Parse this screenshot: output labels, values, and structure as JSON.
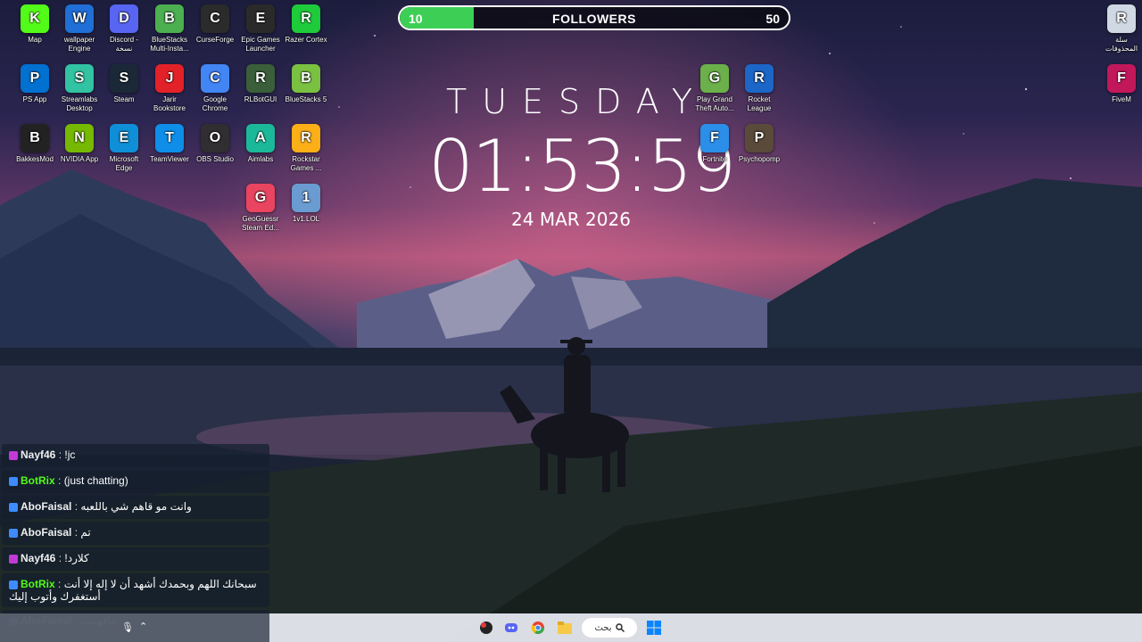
{
  "followers_goal": {
    "title": "FOLLOWERS",
    "start_label": "10",
    "end_label": "50",
    "progress_fraction": 0.19,
    "fill_color": "#3dcf55"
  },
  "clock": {
    "day": "TUESDAY",
    "time": "01:53:59",
    "date": "24 MAR 2026"
  },
  "desktop_icons": [
    {
      "label": "Map",
      "icon": "kick-icon",
      "color": "#53fc18"
    },
    {
      "label": "wallpaper Engine",
      "icon": "wallpaper-engine-icon",
      "color": "#1f6fd6"
    },
    {
      "label": "Discord - نسخة",
      "icon": "discord-icon",
      "color": "#5865f2"
    },
    {
      "label": "BlueStacks Multi-Insta...",
      "icon": "bluestacks-multi-icon",
      "color": "#4caf50"
    },
    {
      "label": "CurseForge",
      "icon": "curseforge-icon",
      "color": "#2b2b2b"
    },
    {
      "label": "Epic Games Launcher",
      "icon": "epic-games-icon",
      "color": "#2a2a2a"
    },
    {
      "label": "Razer Cortex",
      "icon": "razer-cortex-icon",
      "color": "#1ecb3a"
    },
    {
      "label": "PS App",
      "icon": "playstation-icon",
      "color": "#0070d1"
    },
    {
      "label": "Streamlabs Desktop",
      "icon": "streamlabs-icon",
      "color": "#31c3a2"
    },
    {
      "label": "Steam",
      "icon": "steam-icon",
      "color": "#1b2838"
    },
    {
      "label": "Jarir Bookstore",
      "icon": "jarir-icon",
      "color": "#e32128"
    },
    {
      "label": "Google Chrome",
      "icon": "chrome-icon",
      "color": "#4285f4"
    },
    {
      "label": "RLBotGUI",
      "icon": "rlbot-icon",
      "color": "#3a5f3a"
    },
    {
      "label": "BlueStacks 5",
      "icon": "bluestacks-icon",
      "color": "#7ac142"
    },
    {
      "label": "BakkesMod",
      "icon": "bakkesmod-icon",
      "color": "#222222"
    },
    {
      "label": "NVIDIA App",
      "icon": "nvidia-icon",
      "color": "#76b900"
    },
    {
      "label": "Microsoft Edge",
      "icon": "edge-icon",
      "color": "#0f8fd8"
    },
    {
      "label": "TeamViewer",
      "icon": "teamviewer-icon",
      "color": "#0e8ee9"
    },
    {
      "label": "OBS Studio",
      "icon": "obs-icon",
      "color": "#302e31"
    },
    {
      "label": "Aimlabs",
      "icon": "aimlabs-icon",
      "color": "#1bb99a"
    },
    {
      "label": "Rockstar Games ...",
      "icon": "rockstar-icon",
      "color": "#fcaf17"
    },
    {
      "label": "GeoGuessr Steam Ed...",
      "icon": "geoguessr-icon",
      "color": "#e94560"
    },
    {
      "label": "1v1.LOL",
      "icon": "1v1lol-icon",
      "color": "#6a9bd1"
    }
  ],
  "right_icons": [
    {
      "label": "Play Grand Theft Auto...",
      "icon": "gta-icon",
      "color": "#6bb04a"
    },
    {
      "label": "Rocket League",
      "icon": "rocket-league-icon",
      "color": "#1c66c7"
    },
    {
      "label": "Fortnite",
      "icon": "fortnite-icon",
      "color": "#2b8ee8"
    },
    {
      "label": "Psychopomp",
      "icon": "psychopomp-icon",
      "color": "#5a4a3a"
    }
  ],
  "corner_icons": [
    {
      "label": "سلة المحذوفات",
      "icon": "recycle-bin-icon",
      "color": "#cfd8e3"
    },
    {
      "label": "FiveM",
      "icon": "fivem-icon",
      "color": "#c2185b"
    }
  ],
  "chat": [
    {
      "user": "Nayf46",
      "user_color": "#f0f0f0",
      "badge_color": "#c23ad6",
      "message": "!jc"
    },
    {
      "user": "BotRix",
      "user_color": "#53fc18",
      "badge_color": "#3d8bff",
      "message": "(just chatting)"
    },
    {
      "user": "AboFaisal",
      "user_color": "#f0f0f0",
      "badge_color": "#3d8bff",
      "message": "وانت مو قاهم شي باللعبه"
    },
    {
      "user": "AboFaisal",
      "user_color": "#f0f0f0",
      "badge_color": "#3d8bff",
      "message": "تم"
    },
    {
      "user": "Nayf46",
      "user_color": "#f0f0f0",
      "badge_color": "#c23ad6",
      "message": "!كلارد"
    },
    {
      "user": "BotRix",
      "user_color": "#53fc18",
      "badge_color": "#3d8bff",
      "message": "سبحانك اللهم وبحمدك أشهد أن لا إله إلا أنت أستغفرك وأتوب إليك"
    },
    {
      "user": "AboFaisal",
      "user_color": "#f0f0f0",
      "badge_color": "#3d8bff",
      "message": "مافهمت"
    }
  ],
  "taskbar": {
    "search_label": "بحث",
    "search_icon": "search-icon",
    "start_icon": "windows-start-icon",
    "apps": [
      {
        "icon": "kick-taskbar-icon",
        "color": "#222222"
      },
      {
        "icon": "discord-taskbar-icon",
        "color": "#5865f2"
      },
      {
        "icon": "chrome-taskbar-icon",
        "color": "#4285f4"
      },
      {
        "icon": "file-explorer-icon",
        "color": "#f7c948"
      }
    ],
    "tray": {
      "mic_icon": "microphone-icon",
      "chevron_icon": "chevron-up-icon"
    }
  }
}
